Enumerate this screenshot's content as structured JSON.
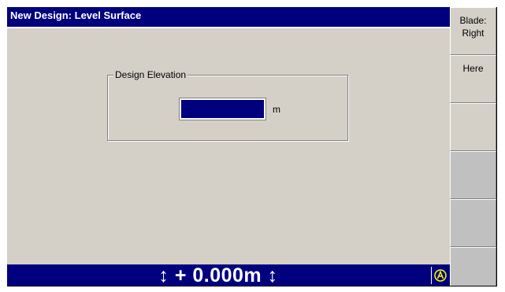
{
  "title": "New Design: Level Surface",
  "design_elevation": {
    "label": "Design Elevation",
    "value": "",
    "unit": "m"
  },
  "status_bar": {
    "elevation_readout": "↕ + 0.000m ↕",
    "status_icon": "auto-mode-icon"
  },
  "softkeys": [
    {
      "label": "Blade:\nRight"
    },
    {
      "label": "Here"
    },
    {
      "label": ""
    },
    {
      "label": ""
    },
    {
      "label": ""
    },
    {
      "label": ""
    }
  ],
  "colors": {
    "title_bar": "#00007f",
    "panel": "#d4d0c8",
    "input_bg": "#00007f",
    "status_icon": "#ffff00"
  }
}
